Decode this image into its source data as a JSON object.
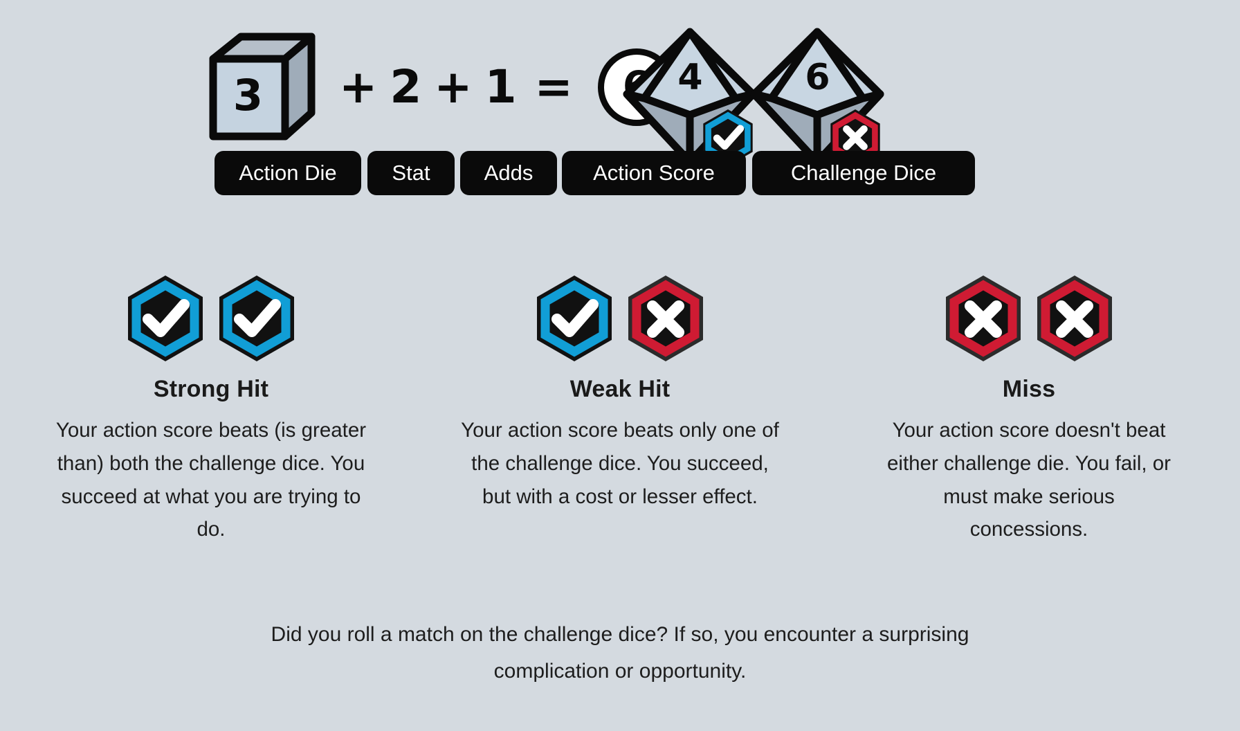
{
  "background_color": "#d4dae0",
  "colors": {
    "ink": "#0a0a0a",
    "success_blue": "#119ed6",
    "fail_red": "#cf1b33",
    "die_face_light": "#c5d3e0",
    "die_face_mid": "#9facb9",
    "die_face_top": "#b6bfc9",
    "white": "#ffffff"
  },
  "formula": {
    "action_die": {
      "icon": "cube-die-icon",
      "value": "3"
    },
    "plus_1": "+",
    "stat_value": "2",
    "plus_2": "+",
    "adds_value": "1",
    "equals": "=",
    "action_score": {
      "icon": "circle-score-icon",
      "value": "6"
    },
    "challenge_dice": [
      {
        "icon": "d10-die-icon",
        "value": "4",
        "result_icon": "check-hex-icon",
        "result": "success",
        "color": "#119ed6"
      },
      {
        "icon": "d10-die-icon",
        "value": "6",
        "result_icon": "x-hex-icon",
        "result": "fail",
        "color": "#cf1b33"
      }
    ],
    "labels": [
      "Action Die",
      "Stat",
      "Adds",
      "Action Score",
      "Challenge Dice"
    ]
  },
  "outcomes": [
    {
      "id": "strong-hit",
      "title": "Strong Hit",
      "description": "Your action score beats (is greater than) both the challenge dice. You succeed at what you are trying to do.",
      "icons": [
        {
          "name": "check-hex-icon",
          "glyph": "check",
          "color": "#119ed6"
        },
        {
          "name": "check-hex-icon",
          "glyph": "check",
          "color": "#119ed6"
        }
      ]
    },
    {
      "id": "weak-hit",
      "title": "Weak Hit",
      "description": "Your action score beats only one of the challenge dice. You succeed, but with a cost or lesser effect.",
      "icons": [
        {
          "name": "check-hex-icon",
          "glyph": "check",
          "color": "#119ed6"
        },
        {
          "name": "x-hex-icon",
          "glyph": "x",
          "color": "#cf1b33"
        }
      ]
    },
    {
      "id": "miss",
      "title": "Miss",
      "description": "Your action score doesn't beat either challenge die. You fail, or must make serious concessions.",
      "icons": [
        {
          "name": "x-hex-icon",
          "glyph": "x",
          "color": "#cf1b33"
        },
        {
          "name": "x-hex-icon",
          "glyph": "x",
          "color": "#cf1b33"
        }
      ]
    }
  ],
  "footer": {
    "note": "Did you roll a match on the challenge dice? If so, you encounter a surprising complication or opportunity."
  }
}
